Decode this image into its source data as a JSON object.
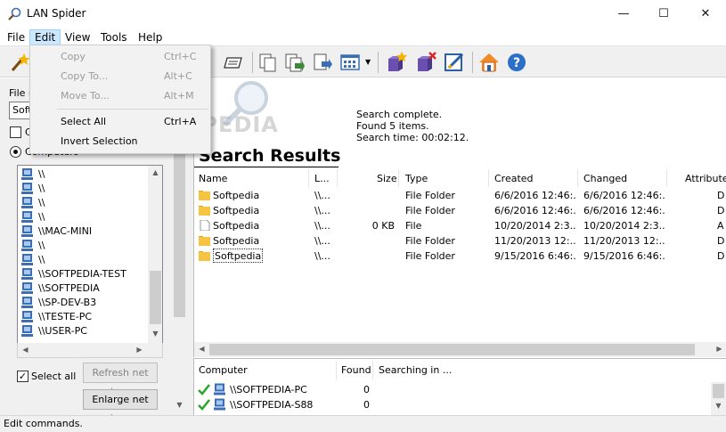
{
  "window": {
    "title": "LAN Spider",
    "minimize": "—",
    "maximize": "☐",
    "close": "✕"
  },
  "menu": [
    "File",
    "Edit",
    "View",
    "Tools",
    "Help"
  ],
  "edit_menu": {
    "items": [
      {
        "label": "Copy",
        "shortcut": "Ctrl+C",
        "enabled": false
      },
      {
        "label": "Copy To...",
        "shortcut": "Alt+C",
        "enabled": false
      },
      {
        "label": "Move To...",
        "shortcut": "Alt+M",
        "enabled": false
      },
      {
        "label": "Select All",
        "shortcut": "Ctrl+A",
        "enabled": true
      },
      {
        "label": "Invert Selection",
        "shortcut": "",
        "enabled": true
      }
    ]
  },
  "toolbar": {
    "icons": [
      "wizard-icon",
      "find-icon",
      "stop-icon",
      "print-icon",
      "export-icon",
      "copy-icon",
      "copy-to-icon",
      "move-to-icon",
      "view-icon",
      "add-icon",
      "remove-icon",
      "edit-icon",
      "home-icon",
      "help-icon"
    ]
  },
  "left": {
    "file_label": "File n",
    "file_value": "Soft",
    "checkbox_label": "C",
    "radio_label": "Computers",
    "computers": [
      "\\\\",
      "\\\\",
      "\\\\",
      "\\\\",
      "\\\\MAC-MINI",
      "\\\\",
      "\\\\",
      "\\\\SOFTPEDIA-TEST",
      "\\\\SOFTPEDIA",
      "\\\\SP-DEV-B3",
      "\\\\TESTE-PC",
      "\\\\USER-PC"
    ],
    "select_all": "Select all",
    "select_all_checked": "✓",
    "refresh_btn": "Refresh net tree",
    "enlarge_btn": "Enlarge net tree"
  },
  "results": {
    "status": [
      "Search complete.",
      "Found 5 items.",
      "Search time: 00:02:12."
    ],
    "title": "Search Results",
    "columns": [
      "Name",
      "L...",
      "Size",
      "Type",
      "Created",
      "Changed",
      "Attributes"
    ],
    "rows": [
      {
        "icon": "folder",
        "name": "Softpedia",
        "loc": "\\\\...",
        "size": "",
        "type": "File Folder",
        "created": "6/6/2016 12:46:...",
        "changed": "6/6/2016 12:46:...",
        "attr": "D"
      },
      {
        "icon": "folder",
        "name": "Softpedia",
        "loc": "\\\\...",
        "size": "",
        "type": "File Folder",
        "created": "6/6/2016 12:46:...",
        "changed": "6/6/2016 12:46:...",
        "attr": "D"
      },
      {
        "icon": "file",
        "name": "Softpedia",
        "loc": "\\\\...",
        "size": "0 KB",
        "type": "File",
        "created": "10/20/2014 2:3...",
        "changed": "10/20/2014 2:3...",
        "attr": "A"
      },
      {
        "icon": "folder",
        "name": "Softpedia",
        "loc": "\\\\...",
        "size": "",
        "type": "File Folder",
        "created": "11/20/2013 12:...",
        "changed": "11/20/2013 12:...",
        "attr": "D"
      },
      {
        "icon": "folder",
        "name": "Softpedia",
        "loc": "\\\\...",
        "size": "",
        "type": "File Folder",
        "created": "9/15/2016 6:46:...",
        "changed": "9/15/2016 6:46:...",
        "attr": "D"
      }
    ]
  },
  "bottom": {
    "columns": [
      "Computer",
      "Found",
      "Searching in ..."
    ],
    "rows": [
      {
        "computer": "\\\\SOFTPEDIA-PC",
        "found": "0",
        "searching": ""
      },
      {
        "computer": "\\\\SOFTPEDIA-S88",
        "found": "0",
        "searching": ""
      }
    ]
  },
  "statusbar": "Edit commands.",
  "watermark": "SOFTPEDIA",
  "colors": {
    "menu_highlight": "#cce8ff",
    "check_green": "#2aa52a",
    "folder": "#f5c542"
  }
}
